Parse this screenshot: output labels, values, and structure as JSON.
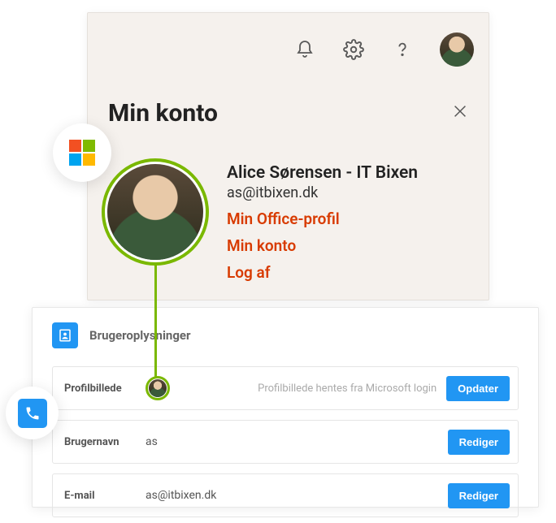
{
  "account": {
    "title": "Min konto",
    "name": "Alice Sørensen - IT Bixen",
    "email": "as@itbixen.dk",
    "links": {
      "office_profile": "Min Office-profil",
      "my_account": "Min konto",
      "logout": "Log af"
    }
  },
  "panel": {
    "title": "Brugeroplysninger",
    "fields": {
      "profile_picture": {
        "label": "Profilbillede",
        "hint": "Profilbillede hentes fra Microsoft login",
        "button": "Opdater"
      },
      "username": {
        "label": "Brugernavn",
        "value": "as",
        "button": "Rediger"
      },
      "email": {
        "label": "E-mail",
        "value": "as@itbixen.dk",
        "button": "Rediger"
      }
    }
  },
  "colors": {
    "ms_red": "#f25022",
    "ms_green": "#7fba00",
    "ms_blue": "#00a4ef",
    "ms_yellow": "#ffb900"
  }
}
